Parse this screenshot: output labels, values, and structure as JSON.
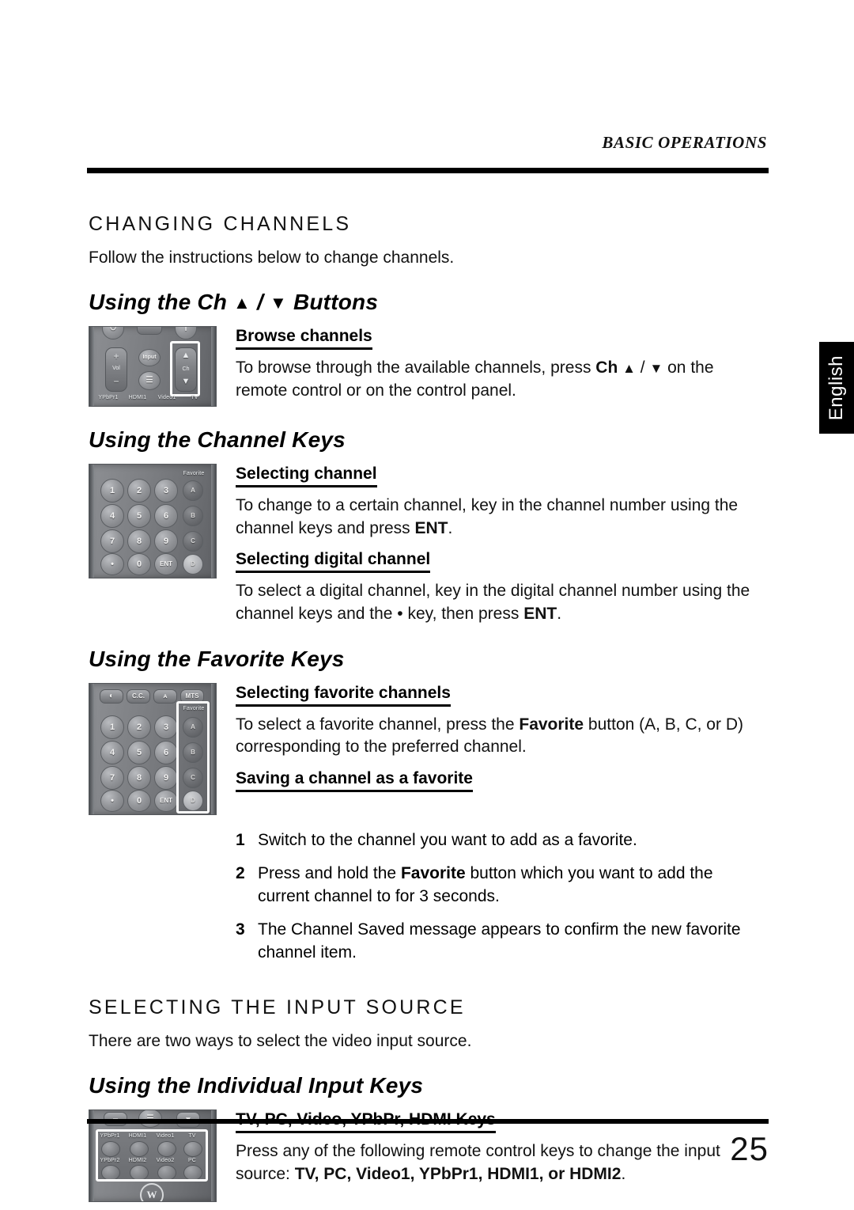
{
  "page": {
    "running_head": "BASIC OPERATIONS",
    "number": "25",
    "language_tab": "English"
  },
  "sections": [
    {
      "id": "changing-channels",
      "heading": "CHANGING CHANNELS",
      "intro": "Follow the instructions below to change channels."
    },
    {
      "id": "selecting-input-source",
      "heading": "SELECTING THE INPUT SOURCE",
      "intro": "There are two ways to select the video input source."
    }
  ],
  "subsections": {
    "ch_buttons": {
      "title_pre": "Using the Ch ",
      "title_up": "▲",
      "title_sep": " / ",
      "title_down": "▼",
      "title_post": " Buttons",
      "heading": "Browse channels",
      "body_1": "To browse through the available channels, press ",
      "body_bold": "Ch",
      "body_up": "▲",
      "body_sep": " / ",
      "body_down": "▼",
      "body_2": " on the remote control or on the control panel."
    },
    "channel_keys": {
      "title": "Using the Channel Keys",
      "heading_1": "Selecting channel",
      "body_1a": "To change to a certain channel, key in the channel number using the channel keys and press ",
      "body_1b": "ENT",
      "body_1c": ".",
      "heading_2": "Selecting digital channel",
      "body_2a": "To select a digital channel, key in the digital channel number using the channel keys and the • key, then press ",
      "body_2b": "ENT",
      "body_2c": "."
    },
    "favorite_keys": {
      "title": "Using the Favorite Keys",
      "heading_1": "Selecting favorite channels ",
      "body_1a": "To select a favorite channel, press the ",
      "body_1b": "Favorite",
      "body_1c": " button (A, B, C, or D) corresponding to the preferred channel.",
      "heading_2": "Saving a channel as a favorite",
      "steps": [
        {
          "num": "1",
          "text_a": "Switch to the channel you want to add as a favorite.",
          "bold": "",
          "text_b": ""
        },
        {
          "num": "2",
          "text_a": "Press and hold the ",
          "bold": "Favorite",
          "text_b": " button which you want to add the current channel to for 3 seconds."
        },
        {
          "num": "3",
          "text_a": "The Channel Saved message appears to confirm the new favorite channel item.",
          "bold": "",
          "text_b": ""
        }
      ]
    },
    "input_keys": {
      "title": "Using the Individual Input Keys",
      "heading": "TV, PC, Video, YPbPr, HDMI Keys",
      "body_a": "Press any of the following remote control keys to change the input source: ",
      "body_bold": "TV, PC, Video1, YPbPr1, HDMI1, or HDMI2",
      "body_b": "."
    }
  },
  "artwork": {
    "remote_ch": {
      "name": "remote-control-channel-rocker",
      "vol_plus": "+",
      "vol_label": "Vol",
      "vol_minus": "−",
      "input_button": "Input",
      "menu_button": "☰",
      "ch_up": "▲",
      "ch_label": "Ch",
      "ch_down": "▼",
      "bottom_labels": [
        "YPbPr1",
        "HDMI1",
        "Video1",
        "TV"
      ]
    },
    "remote_keypad": {
      "name": "remote-control-number-keypad",
      "favorite_label": "Favorite",
      "keys": [
        [
          "1",
          "2",
          "3",
          "A"
        ],
        [
          "4",
          "5",
          "6",
          "B"
        ],
        [
          "7",
          "8",
          "9",
          "C"
        ],
        [
          "•",
          "0",
          "ENT",
          "D"
        ]
      ]
    },
    "remote_favorite": {
      "name": "remote-control-favorite-keys",
      "top_buttons": [
        "◐",
        "C.C.",
        "ᴀ",
        "MTS"
      ],
      "favorite_label": "Favorite",
      "keys": [
        [
          "1",
          "2",
          "3",
          "A"
        ],
        [
          "4",
          "5",
          "6",
          "B"
        ],
        [
          "7",
          "8",
          "9",
          "C"
        ],
        [
          "•",
          "0",
          "ENT",
          "D"
        ]
      ]
    },
    "remote_input": {
      "name": "remote-control-input-keys",
      "top_minus": "−",
      "top_menu": "☰",
      "top_down": "▼",
      "row1_labels": [
        "YPbPr1",
        "HDMI1",
        "Video1",
        "TV"
      ],
      "row2_labels": [
        "YPbPr2",
        "HDMI2",
        "Video2",
        "PC"
      ],
      "logo": "W"
    }
  },
  "colors": {
    "ink": "#000000",
    "paper": "#ffffff",
    "remote_body": "#7e8084",
    "highlight": "#ffffff"
  }
}
